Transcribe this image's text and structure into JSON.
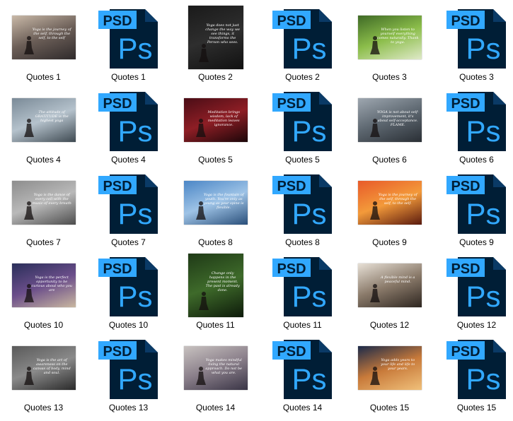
{
  "colors": {
    "psd_tab": "#31a8ff",
    "psd_tab_text": "#001e36",
    "ps_bg": "#001e36",
    "ps_text": "#31a8ff",
    "fold": "#0a3a66"
  },
  "psd": {
    "tab_text": "PSD",
    "logo_text": "Ps",
    "icon": "photoshop-file-icon"
  },
  "items": [
    {
      "label": "Quotes 1",
      "kind": "jpg",
      "bg": [
        "#c9b9a8",
        "#6b5e57",
        "#2f2a2b"
      ],
      "quote": "Yoga is the journey of the self, through the self, to the self"
    },
    {
      "label": "Quotes 1",
      "kind": "psd"
    },
    {
      "label": "Quotes 2",
      "kind": "jpg",
      "tall": true,
      "bg": [
        "#1a1a1a",
        "#2e2e2e",
        "#111"
      ],
      "quote": "Yoga does not just change the way we see things, it transforms the Person who sees."
    },
    {
      "label": "Quotes 2",
      "kind": "psd"
    },
    {
      "label": "Quotes 3",
      "kind": "jpg",
      "bg": [
        "#3f6a26",
        "#8bbd4a",
        "#dfe9c8"
      ],
      "quote": "When you listen to yourself everything comes naturally. Thank to yoga."
    },
    {
      "label": "Quotes 3",
      "kind": "psd"
    },
    {
      "label": "Quotes 4",
      "kind": "jpg",
      "bg": [
        "#7a8a97",
        "#b5c2cc",
        "#3f4a52"
      ],
      "quote": "The attitude of GRATITUDE is the highest yoga"
    },
    {
      "label": "Quotes 4",
      "kind": "psd"
    },
    {
      "label": "Quotes 5",
      "kind": "jpg",
      "bg": [
        "#4a0d16",
        "#8e1e25",
        "#1c0609"
      ],
      "quote": "Meditation brings wisdom, lack of meditation leaves ignorance."
    },
    {
      "label": "Quotes 5",
      "kind": "psd"
    },
    {
      "label": "Quotes 6",
      "kind": "jpg",
      "bg": [
        "#9ea7b0",
        "#5d6770",
        "#2a2f35"
      ],
      "quote": "YOGA is not about self-improvement, it's about self-acceptance. FLAME."
    },
    {
      "label": "Quotes 6",
      "kind": "psd"
    },
    {
      "label": "Quotes 7",
      "kind": "jpg",
      "bg": [
        "#8d8d8d",
        "#b9b9b9",
        "#4d4d4d"
      ],
      "quote": "Yoga is the dance of every cell with the music of every breath"
    },
    {
      "label": "Quotes 7",
      "kind": "psd"
    },
    {
      "label": "Quotes 8",
      "kind": "jpg",
      "bg": [
        "#4b86c6",
        "#9ec3e6",
        "#2a4f7a"
      ],
      "quote": "Yoga is the fountain of youth. You're only as young as your spine is flexible."
    },
    {
      "label": "Quotes 8",
      "kind": "psd"
    },
    {
      "label": "Quotes 9",
      "kind": "jpg",
      "bg": [
        "#e85a2a",
        "#f39a3a",
        "#5a1a0e"
      ],
      "quote": "Yoga is the journey of the self, through the self, to the self."
    },
    {
      "label": "Quotes 9",
      "kind": "psd"
    },
    {
      "label": "Quotes 10",
      "kind": "jpg",
      "bg": [
        "#2a2f5a",
        "#6b4e8a",
        "#c9b7a0"
      ],
      "quote": "Yoga is the perfect opportunity to be curious about who you are"
    },
    {
      "label": "Quotes 10",
      "kind": "psd"
    },
    {
      "label": "Quotes 11",
      "kind": "jpg",
      "tall": true,
      "bg": [
        "#1f3a17",
        "#3e6a2a",
        "#0d1a0a"
      ],
      "quote": "Change only happens in the present moment. The past is already done."
    },
    {
      "label": "Quotes 11",
      "kind": "psd"
    },
    {
      "label": "Quotes 12",
      "kind": "jpg",
      "bg": [
        "#e7e0d6",
        "#8a7a6a",
        "#2e2620"
      ],
      "quote": "A flexible mind is a peaceful mind."
    },
    {
      "label": "Quotes 12",
      "kind": "psd"
    },
    {
      "label": "Quotes 13",
      "kind": "jpg",
      "bg": [
        "#5a5a5a",
        "#8a8a8a",
        "#2a2a2a"
      ],
      "quote": "Yoga is the art of awareness on the canvas of body, mind and soul."
    },
    {
      "label": "Quotes 13",
      "kind": "psd"
    },
    {
      "label": "Quotes 14",
      "kind": "jpg",
      "bg": [
        "#c8c2c0",
        "#8a7f8a",
        "#3a3546"
      ],
      "quote": "Yoga makes mindful living the natural approach. Do not be what you are."
    },
    {
      "label": "Quotes 14",
      "kind": "psd"
    },
    {
      "label": "Quotes 15",
      "kind": "jpg",
      "bg": [
        "#1b2a4a",
        "#c87a3a",
        "#f0c07a"
      ],
      "quote": "Yoga adds years to your life and life to your years."
    },
    {
      "label": "Quotes 15",
      "kind": "psd"
    }
  ]
}
